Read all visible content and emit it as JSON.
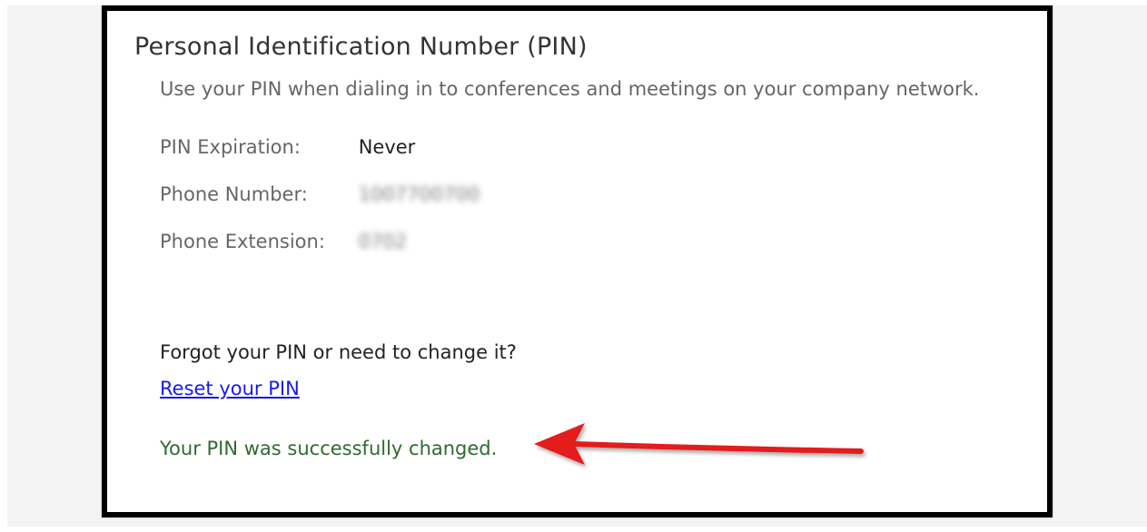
{
  "pin_section": {
    "title": "Personal Identification Number (PIN)",
    "description": "Use your PIN when dialing in to conferences and meetings on your company network.",
    "fields": [
      {
        "label": "PIN Expiration:",
        "value": "Never"
      },
      {
        "label": "Phone Number:",
        "value": "1007700700"
      },
      {
        "label": "Phone Extension:",
        "value": "0702"
      }
    ],
    "forgot_prompt": "Forgot your PIN or need to change it?",
    "reset_link": "Reset your PIN",
    "success_message": "Your PIN was successfully changed."
  },
  "colors": {
    "link": "#1a1ae6",
    "success": "#2e6b2e",
    "arrow": "#e31b1b"
  },
  "annotation": {
    "icon": "red-arrow-icon"
  }
}
